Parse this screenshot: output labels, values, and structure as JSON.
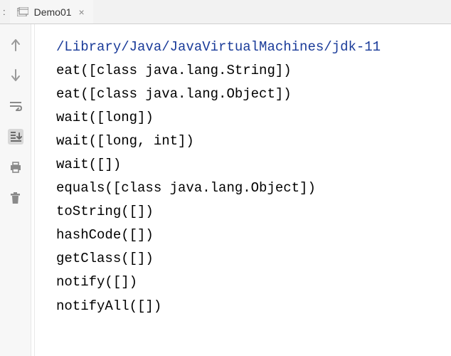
{
  "topbar": {
    "prefix": ":",
    "tab": {
      "title": "Demo01"
    }
  },
  "console": {
    "lines": [
      {
        "text": "/Library/Java/JavaVirtualMachines/jdk-11",
        "type": "path"
      },
      {
        "text": "eat([class java.lang.String])",
        "type": "plain"
      },
      {
        "text": "eat([class java.lang.Object])",
        "type": "plain"
      },
      {
        "text": "wait([long])",
        "type": "plain"
      },
      {
        "text": "wait([long, int])",
        "type": "plain"
      },
      {
        "text": "wait([])",
        "type": "plain"
      },
      {
        "text": "equals([class java.lang.Object])",
        "type": "plain"
      },
      {
        "text": "toString([])",
        "type": "plain"
      },
      {
        "text": "hashCode([])",
        "type": "plain"
      },
      {
        "text": "getClass([])",
        "type": "plain"
      },
      {
        "text": "notify([])",
        "type": "plain"
      },
      {
        "text": "notifyAll([])",
        "type": "plain"
      }
    ]
  }
}
